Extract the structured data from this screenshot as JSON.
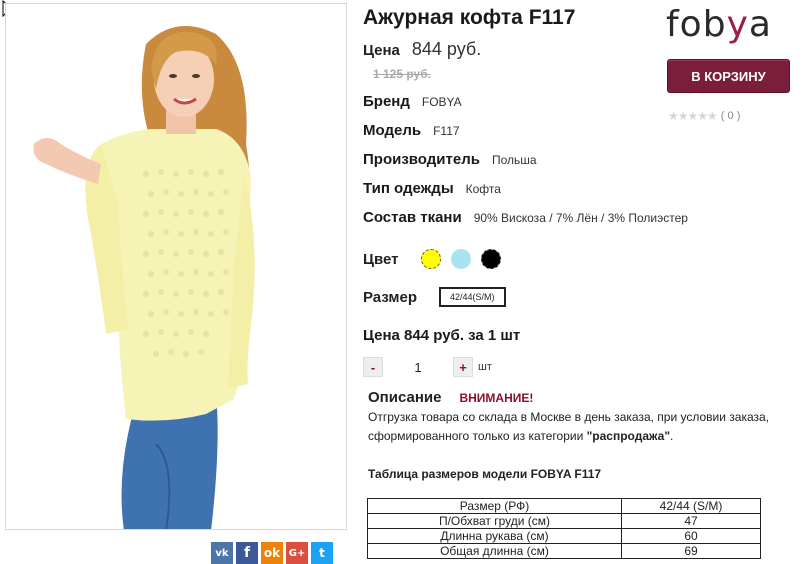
{
  "product": {
    "title": "Ажурная кофта F117",
    "price_label": "Цена",
    "price": "844 руб.",
    "old_price": "1 125 руб."
  },
  "specs": [
    {
      "key": "Бренд",
      "value": "FOBYA"
    },
    {
      "key": "Модель",
      "value": "F117"
    },
    {
      "key": "Производитель",
      "value": "Польша"
    },
    {
      "key": "Тип одежды",
      "value": "Кофта"
    },
    {
      "key": "Состав ткани",
      "value": "90% Вискоза / 7% Лён / 3% Полиэстер"
    }
  ],
  "brand_logo": {
    "part1": "fob",
    "part2": "y",
    "part3": "a",
    "accent": "#9c1f49"
  },
  "cart_button": "В КОРЗИНУ",
  "rating": {
    "stars": "★★★★★",
    "count": "( 0 )",
    "value": 0
  },
  "color": {
    "label": "Цвет",
    "swatches": [
      "#ffff00",
      "#a8e4ef",
      "#000000"
    ]
  },
  "size": {
    "label": "Размер",
    "selected": "42/44(S/M)"
  },
  "quantity": {
    "price_text": "Цена 844 руб. за 1 шт",
    "minus": "-",
    "value": "1",
    "plus": "+",
    "unit": "шт"
  },
  "description": {
    "label": "Описание",
    "warning": "ВНИМАНИЕ!",
    "text_before": "Отгрузка товара со склада в Москве в день заказа, при условии заказа, сформированного только из категории ",
    "text_bold": "\"распродажа\"",
    "text_after": "."
  },
  "size_table": {
    "title": "Таблица размеров модели FOBYA F117",
    "rows": [
      [
        "Размер (РФ)",
        "42/44 (S/M)"
      ],
      [
        "П/Обхват груди (см)",
        "47"
      ],
      [
        "Длинна рукава (см)",
        "60"
      ],
      [
        "Общая длинна (см)",
        "69"
      ]
    ]
  },
  "share": {
    "vk": "vk",
    "fb": "f",
    "ok": "ok",
    "gp": "G+",
    "tw": "t"
  }
}
